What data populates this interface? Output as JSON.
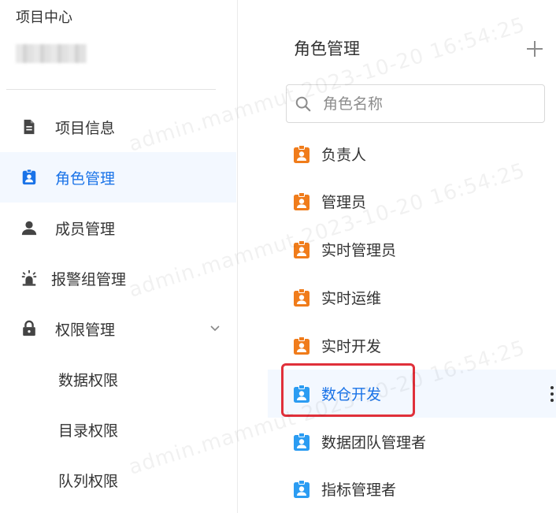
{
  "sidebar": {
    "project_center": "项目中心",
    "items": [
      {
        "label": "项目信息",
        "icon": "document-icon"
      },
      {
        "label": "角色管理",
        "icon": "badge-icon",
        "active": true
      },
      {
        "label": "成员管理",
        "icon": "user-icon"
      },
      {
        "label": "报警组管理",
        "icon": "alarm-light-icon"
      },
      {
        "label": "权限管理",
        "icon": "lock-icon",
        "expanded": true
      }
    ],
    "sub_items": [
      {
        "label": "数据权限"
      },
      {
        "label": "目录权限"
      },
      {
        "label": "队列权限"
      }
    ]
  },
  "roles_panel": {
    "title": "角色管理",
    "search_placeholder": "角色名称",
    "search_value": "",
    "roles": [
      {
        "label": "负责人",
        "color": "#f07c1b"
      },
      {
        "label": "管理员",
        "color": "#f07c1b"
      },
      {
        "label": "实时管理员",
        "color": "#f07c1b"
      },
      {
        "label": "实时运维",
        "color": "#f07c1b"
      },
      {
        "label": "实时开发",
        "color": "#f07c1b"
      },
      {
        "label": "数仓开发",
        "color": "#2b9cf2",
        "selected": true
      },
      {
        "label": "数据团队管理者",
        "color": "#2b9cf2"
      },
      {
        "label": "指标管理者",
        "color": "#2b9cf2"
      }
    ]
  },
  "watermark": "admin.mammut 2023-10-20 16:54:25",
  "colors": {
    "accent": "#1a73e8",
    "active_bg": "#f3f8ff",
    "highlight_border": "#e0303a",
    "orange_role": "#f07c1b",
    "blue_role": "#2b9cf2"
  }
}
